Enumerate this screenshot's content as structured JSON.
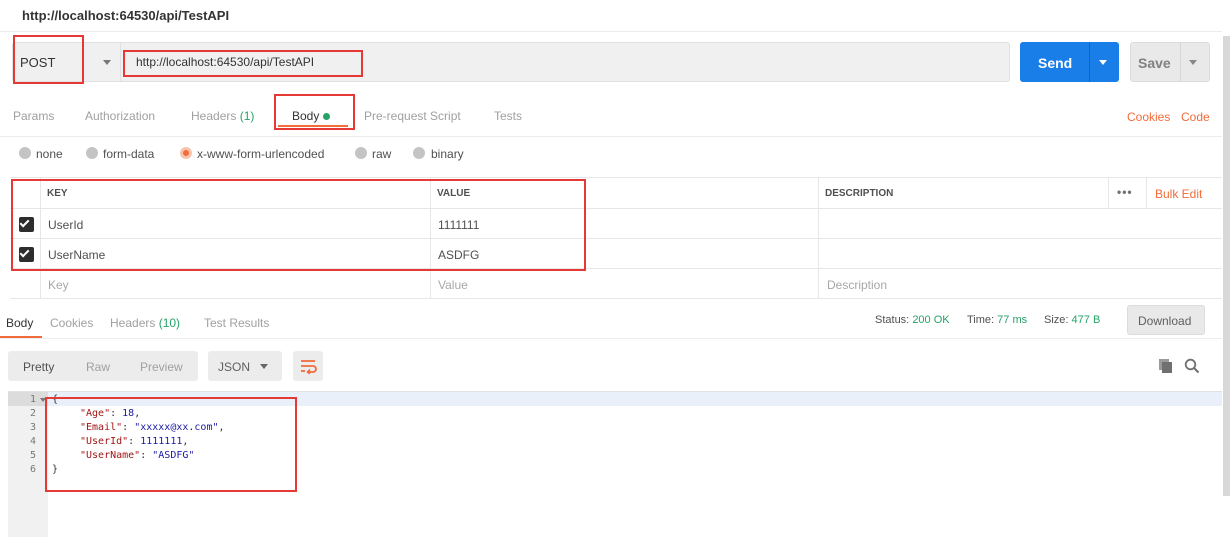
{
  "request": {
    "title": "http://localhost:64530/api/TestAPI",
    "method": "POST",
    "url": "http://localhost:64530/api/TestAPI",
    "send_label": "Send",
    "save_label": "Save"
  },
  "request_tabs": {
    "params": "Params",
    "authorization": "Authorization",
    "headers": "Headers",
    "headers_count": "(1)",
    "body": "Body",
    "pre_request": "Pre-request Script",
    "tests": "Tests",
    "cookies": "Cookies",
    "code": "Code"
  },
  "body_types": {
    "none": "none",
    "form_data": "form-data",
    "urlencoded": "x-www-form-urlencoded",
    "raw": "raw",
    "binary": "binary",
    "selected": "x-www-form-urlencoded"
  },
  "params_table": {
    "headers": {
      "key": "KEY",
      "value": "VALUE",
      "description": "DESCRIPTION"
    },
    "bulk_edit": "Bulk Edit",
    "more": "•••",
    "rows": [
      {
        "checked": true,
        "key": "UserId",
        "value": "1111111"
      },
      {
        "checked": true,
        "key": "UserName",
        "value": "ASDFG"
      }
    ],
    "placeholders": {
      "key": "Key",
      "value": "Value",
      "description": "Description"
    }
  },
  "response": {
    "tabs": {
      "body": "Body",
      "cookies": "Cookies",
      "headers": "Headers",
      "headers_count": "(10)",
      "test_results": "Test Results"
    },
    "status_label": "Status:",
    "status_value": "200 OK",
    "time_label": "Time:",
    "time_value": "77 ms",
    "size_label": "Size:",
    "size_value": "477 B",
    "download_label": "Download",
    "view_modes": {
      "pretty": "Pretty",
      "raw": "Raw",
      "preview": "Preview"
    },
    "format": "JSON",
    "line_numbers": [
      "1",
      "2",
      "3",
      "4",
      "5",
      "6"
    ],
    "json": {
      "open": "{",
      "age_key": "\"Age\"",
      "age_val": "18",
      "email_key": "\"Email\"",
      "email_val": "\"xxxxx@xx.com\"",
      "userid_key": "\"UserId\"",
      "userid_val": "1111111",
      "username_key": "\"UserName\"",
      "username_val": "\"ASDFG\"",
      "close": "}"
    }
  },
  "colors": {
    "accent": "#f26b3a",
    "send": "#1a7ee8",
    "success": "#26a269",
    "annotation": "#e53935"
  }
}
